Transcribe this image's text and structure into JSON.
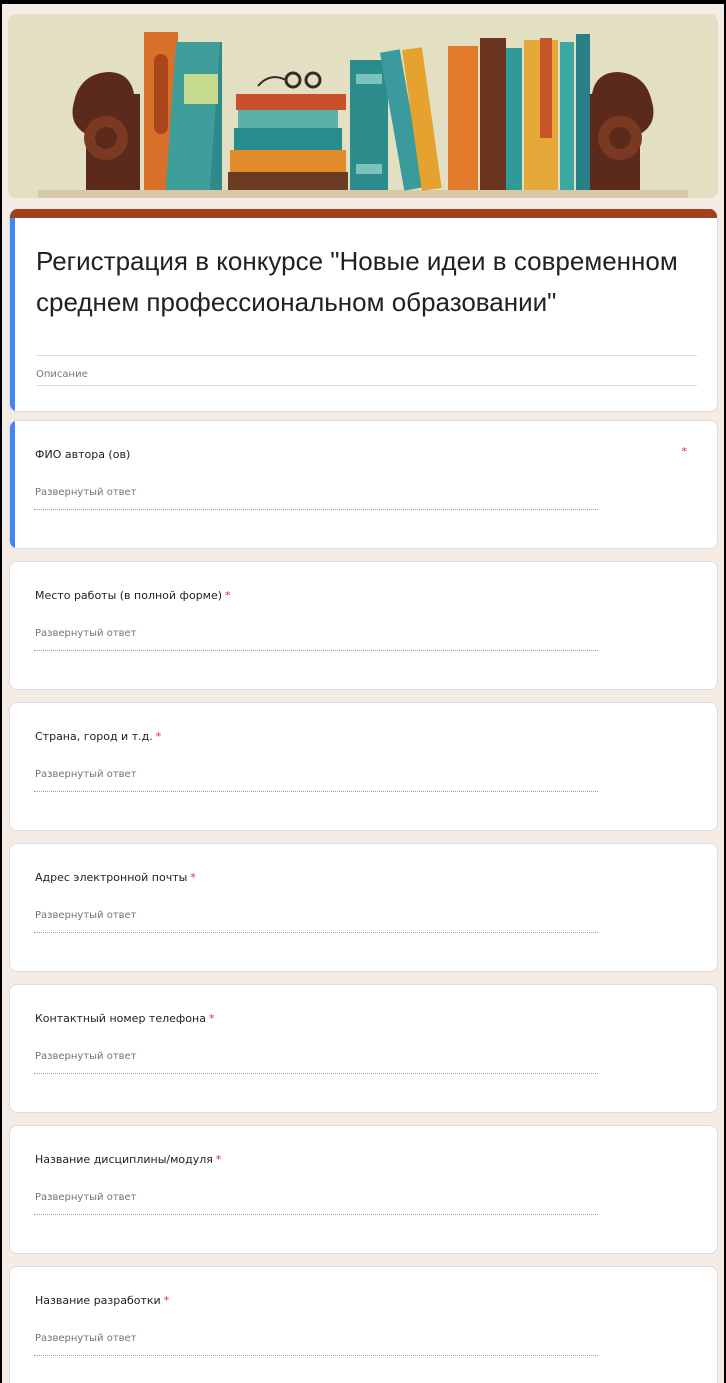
{
  "form": {
    "title": "Регистрация в конкурсе \"Новые идеи в современном среднем профессиональном образовании\"",
    "description": "Описание"
  },
  "required_mark": "*",
  "questions": [
    {
      "label": "ФИО автора (ов)",
      "placeholder": "Развернутый ответ"
    },
    {
      "label": "Место работы (в полной форме)",
      "placeholder": "Развернутый ответ"
    },
    {
      "label": "Страна, город и т.д.",
      "placeholder": "Развернутый ответ"
    },
    {
      "label": "Адрес электронной почты",
      "placeholder": "Развернутый ответ"
    },
    {
      "label": "Контактный номер телефона",
      "placeholder": "Развернутый ответ"
    },
    {
      "label": "Название дисциплины/модуля",
      "placeholder": "Развернутый ответ"
    },
    {
      "label": "Название разработки",
      "placeholder": "Развернутый ответ"
    }
  ],
  "colors": {
    "accent_bar": "#a1401a",
    "active_indicator": "#4285f4",
    "required": "#d93025",
    "page_background": "#f5ece5"
  }
}
